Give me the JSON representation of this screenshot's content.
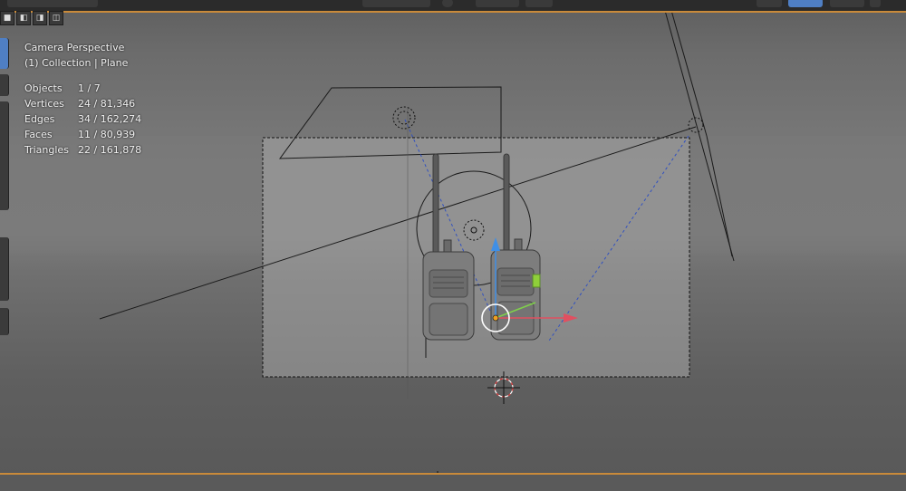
{
  "view": {
    "title": "Camera Perspective",
    "collection_line": "(1) Collection | Plane"
  },
  "stats": [
    {
      "label": "Objects",
      "value": "1 / 7"
    },
    {
      "label": "Vertices",
      "value": "24 / 81,346"
    },
    {
      "label": "Edges",
      "value": "34 / 162,274"
    },
    {
      "label": "Faces",
      "value": "11 / 80,939"
    },
    {
      "label": "Triangles",
      "value": "22 / 161,878"
    }
  ],
  "colors": {
    "accent_orange": "#c98a3a",
    "active_tool": "#4f7fc4",
    "gizmo_x": "#e05060",
    "gizmo_y": "#7fd04a",
    "gizmo_z": "#3f8fe6",
    "origin_dot": "#f0a020"
  },
  "icons": {
    "select_modes": [
      "select-box-icon",
      "select-extend-icon",
      "select-subtract-icon",
      "select-intersect-icon"
    ],
    "objects": [
      "camera-icon",
      "light-icon",
      "walkie-talkie-object",
      "3d-cursor-icon",
      "transform-gizmo-icon"
    ]
  }
}
